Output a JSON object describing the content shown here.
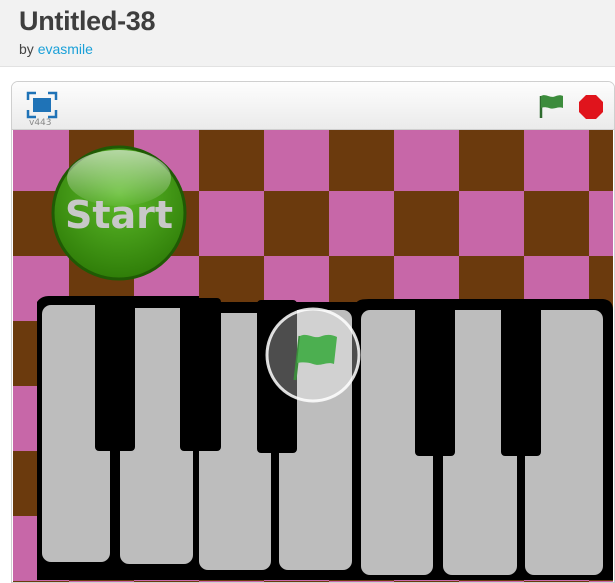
{
  "project": {
    "title": "Untitled-38",
    "by_label": "by",
    "author": "evasmile"
  },
  "player": {
    "version": "v443",
    "fullscreen_icon": "fullscreen-icon",
    "green_flag_icon": "green-flag-icon",
    "stop_icon": "stop-icon"
  },
  "stage": {
    "start_button_label": "Start",
    "overlay_icon": "green-flag-icon",
    "colors": {
      "pink": "#c767a8",
      "brown": "#6b3a0d",
      "start_green": "#3f9b10",
      "flag_green": "#4caf50",
      "key_white": "#bdbdbd",
      "key_black": "#000000",
      "stop_red": "#e0141c"
    }
  }
}
